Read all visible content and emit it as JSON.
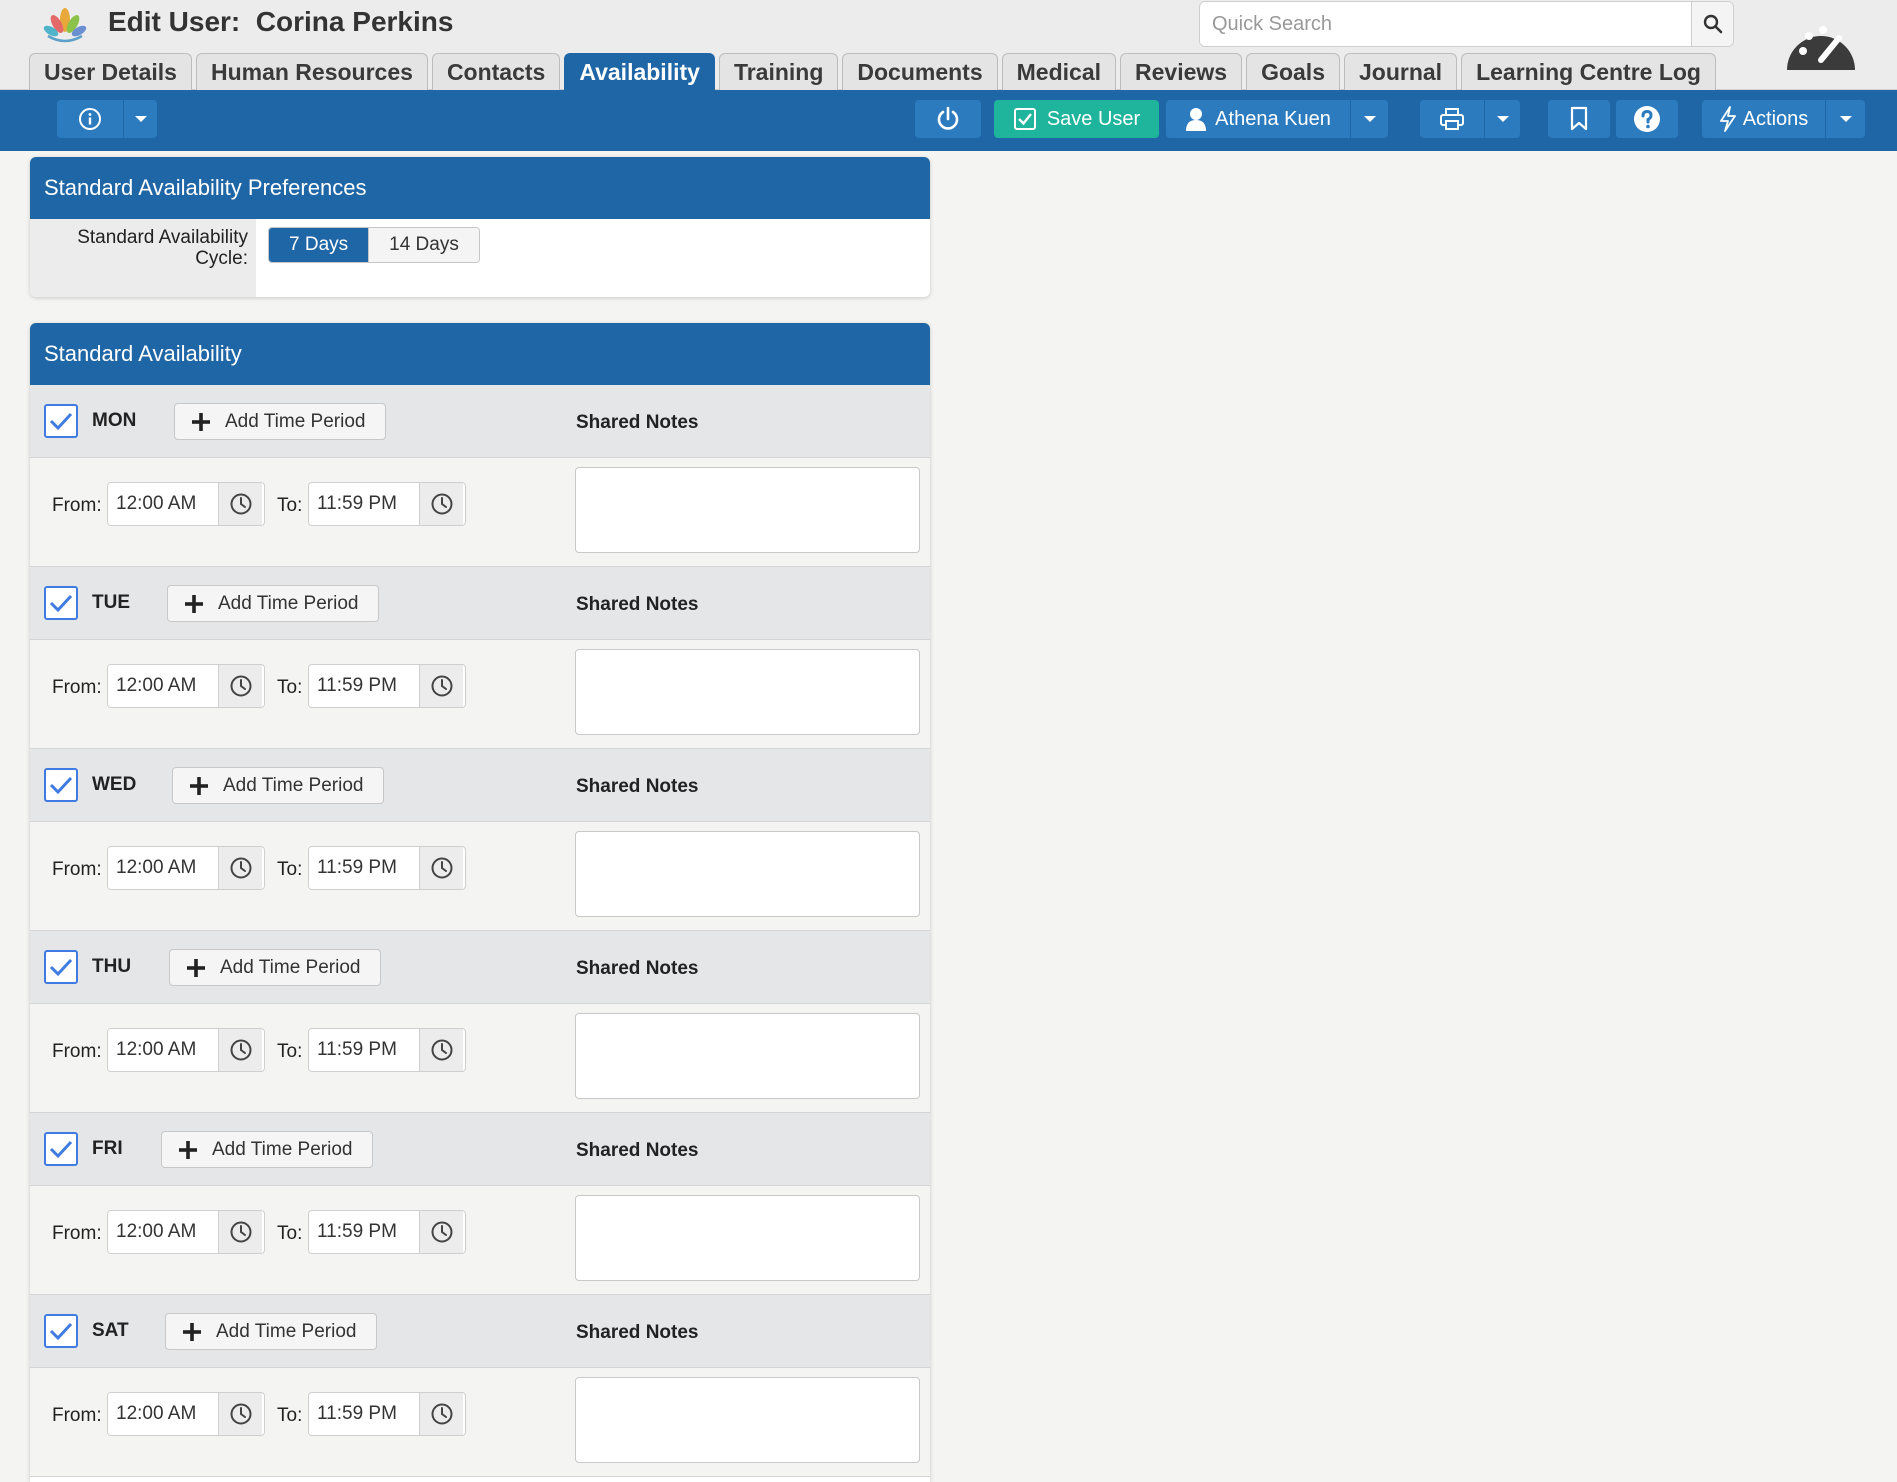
{
  "header": {
    "title": "Edit User:  Corina Perkins",
    "search_placeholder": "Quick Search"
  },
  "tabs": [
    {
      "label": "User Details"
    },
    {
      "label": "Human Resources"
    },
    {
      "label": "Contacts"
    },
    {
      "label": "Availability",
      "active": true
    },
    {
      "label": "Training"
    },
    {
      "label": "Documents"
    },
    {
      "label": "Medical"
    },
    {
      "label": "Reviews"
    },
    {
      "label": "Goals"
    },
    {
      "label": "Journal"
    },
    {
      "label": "Learning Centre Log"
    }
  ],
  "toolbar": {
    "save_label": "Save User",
    "user_label": "Athena Kuen",
    "actions_label": "Actions"
  },
  "preferences": {
    "title": "Standard Availability Preferences",
    "cycle_label": "Standard Availability Cycle:",
    "options": [
      "7 Days",
      "14 Days"
    ],
    "selected": "7 Days"
  },
  "availability": {
    "title": "Standard Availability",
    "add_label": "Add Time Period",
    "notes_label": "Shared Notes",
    "from_label": "From:",
    "to_label": "To:",
    "days": [
      {
        "name": "MON",
        "checked": true,
        "from": "12:00 AM",
        "to": "11:59 PM",
        "notes": ""
      },
      {
        "name": "TUE",
        "checked": true,
        "from": "12:00 AM",
        "to": "11:59 PM",
        "notes": ""
      },
      {
        "name": "WED",
        "checked": true,
        "from": "12:00 AM",
        "to": "11:59 PM",
        "notes": ""
      },
      {
        "name": "THU",
        "checked": true,
        "from": "12:00 AM",
        "to": "11:59 PM",
        "notes": ""
      },
      {
        "name": "FRI",
        "checked": true,
        "from": "12:00 AM",
        "to": "11:59 PM",
        "notes": ""
      },
      {
        "name": "SAT",
        "checked": true,
        "from": "12:00 AM",
        "to": "11:59 PM",
        "notes": ""
      }
    ]
  },
  "colors": {
    "brand_blue": "#1f66a6",
    "save_green": "#1fb49c",
    "checkbox_blue": "#3f7be0"
  }
}
